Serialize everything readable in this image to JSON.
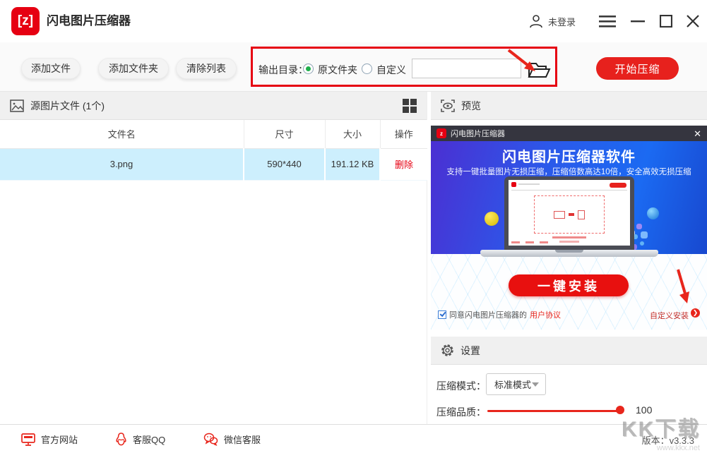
{
  "titlebar": {
    "app_title": "闪电图片压缩器",
    "logo_glyph": "[z]",
    "login_label": "未登录"
  },
  "toolbar": {
    "add_file": "添加文件",
    "add_folder": "添加文件夹",
    "clear_list": "清除列表",
    "output_dir_label": "输出目录：",
    "radio_original": "原文件夹",
    "radio_original_selected": true,
    "radio_custom": "自定义",
    "path_value": "",
    "start_button": "开始压缩"
  },
  "file_panel": {
    "header": "源图片文件 (1个)",
    "columns": [
      "文件名",
      "尺寸",
      "大小",
      "操作"
    ],
    "rows": [
      {
        "name": "3.png",
        "dimensions": "590*440",
        "size": "191.12 KB",
        "action": "删除"
      }
    ]
  },
  "preview": {
    "header": "预览",
    "banner": {
      "titlebar_title": "闪电图片压缩器",
      "mini_logo_glyph": "z",
      "close_glyph": "✕",
      "headline": "闪电图片压缩器软件",
      "subline": "支持一键批量图片无损压缩，压缩倍数高达10倍，安全高效无损压缩",
      "install_button": "一键安装",
      "agree_text": "同意闪电图片压缩器的",
      "agreement_link": "用户协议",
      "custom_install": "自定义安装",
      "custom_install_arrow": "❯"
    }
  },
  "settings": {
    "header": "设置",
    "mode_label": "压缩模式：",
    "mode_value": "标准模式",
    "quality_label": "压缩品质：",
    "quality_value": "100"
  },
  "footer": {
    "official_site": "官方网站",
    "qq": "客服QQ",
    "wechat": "微信客服",
    "version": "版本：v3.3.3",
    "watermark": "KK下载",
    "watermark_url": "www.kkx.net"
  },
  "icons": {
    "menu": "hamburger-menu",
    "minimize": "minus",
    "maximize": "square",
    "close": "x",
    "user": "person-outline",
    "folder": "open-folder-outline",
    "image": "picture-frame",
    "grid": "four-squares",
    "preview": "eye-in-brackets",
    "settings": "gear",
    "site": "monitor",
    "qq": "penguin",
    "wechat": "chat-bubbles"
  },
  "colors": {
    "accent_red": "#e60012",
    "start_button": "#e7211d",
    "row_highlight": "#cdeffd",
    "radio_checked_dot": "#1faf4b",
    "banner_gradient_from": "#4b2fd2",
    "banner_gradient_to": "#1848cf",
    "panel_header_bg": "#f0f0f0",
    "slider": "#e8261c"
  }
}
